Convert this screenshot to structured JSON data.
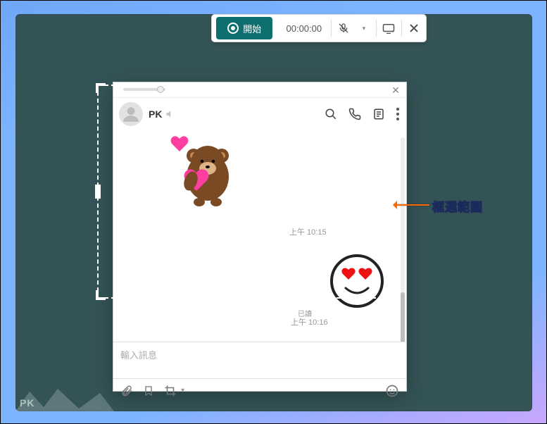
{
  "recorder": {
    "start_label": "開始",
    "timer": "00:00:00"
  },
  "chat": {
    "contact_name": "PK",
    "msg1_time": "上午 10:15",
    "read_label": "已讀",
    "msg2_time": "上午 10:16",
    "input_placeholder": "輸入訊息"
  },
  "annotation": {
    "label": "框選範圍"
  },
  "watermark": "PK"
}
